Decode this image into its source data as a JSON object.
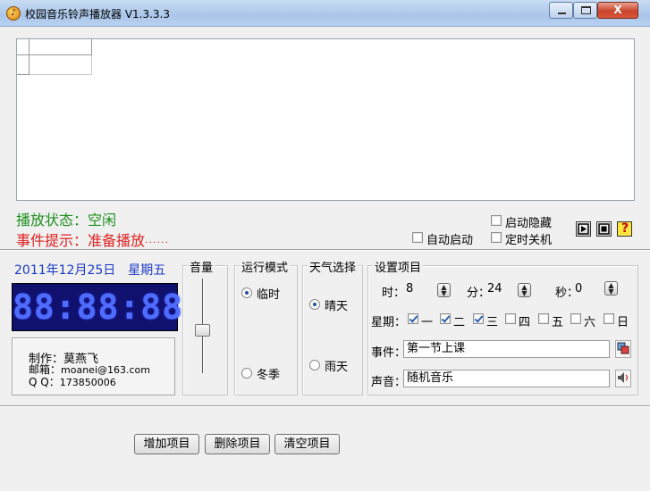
{
  "window": {
    "title": "校园音乐铃声播放器 V1.3.3.3",
    "close_glyph": "X",
    "app_glyph": "♪"
  },
  "status": {
    "play_label": "播放状态：",
    "play_value": "空闲",
    "event_label": "事件提示：",
    "event_value": "准备播放",
    "event_dots": "······"
  },
  "options": {
    "start_hidden": "启动隐藏",
    "auto_start": "自动启动",
    "timed_shutdown": "定时关机"
  },
  "toolbar_icons": {
    "play": "play-icon",
    "stop": "stop-icon",
    "help": "help-icon",
    "help_glyph": "?"
  },
  "date": {
    "date": "2011年12月25日",
    "weekday": "星期五"
  },
  "clock": {
    "display": "88:88:88"
  },
  "credits": {
    "author_label": "制作：",
    "author": "莫燕飞",
    "email_label": "邮箱：",
    "email": "moanei@163.com",
    "qq_label": "Q Q：",
    "qq": "173850006"
  },
  "volume": {
    "label": "音量",
    "level": 0.45
  },
  "run_mode": {
    "title": "运行模式",
    "options": [
      "临时",
      "冬季"
    ],
    "selected": "临时"
  },
  "weather": {
    "title": "天气选择",
    "options": [
      "晴天",
      "雨天"
    ],
    "selected": "晴天"
  },
  "settings": {
    "title": "设置项目",
    "hour_label": "时：",
    "hour": "8",
    "minute_label": "分：",
    "minute": "24",
    "second_label": "秒：",
    "second": "0",
    "weekday_label": "星期：",
    "weekdays": [
      {
        "label": "一",
        "checked": true
      },
      {
        "label": "二",
        "checked": true
      },
      {
        "label": "三",
        "checked": true
      },
      {
        "label": "四",
        "checked": false
      },
      {
        "label": "五",
        "checked": false
      },
      {
        "label": "六",
        "checked": false
      },
      {
        "label": "日",
        "checked": false
      }
    ],
    "event_label": "事件：",
    "event": "第一节上课",
    "sound_label": "声音：",
    "sound": "随机音乐"
  },
  "buttons": {
    "add": "增加项目",
    "delete": "删除项目",
    "clear": "清空项目"
  }
}
